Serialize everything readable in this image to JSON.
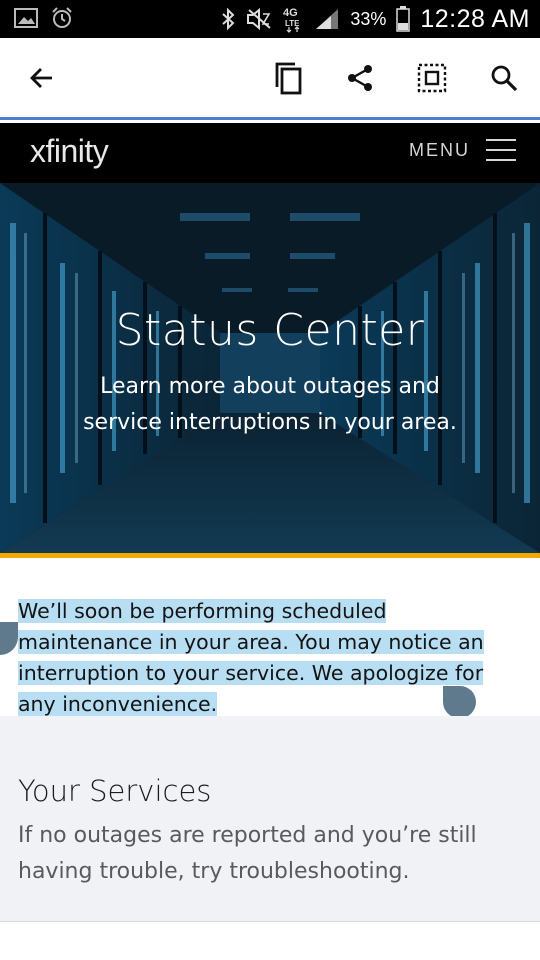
{
  "status_bar": {
    "battery_percent": "33%",
    "time": "12:28 AM",
    "network": "4G LTE",
    "icons": [
      "image-icon",
      "alarm-clock-icon",
      "bluetooth-icon",
      "mute-icon",
      "network-4g-icon",
      "signal-icon",
      "battery-icon"
    ]
  },
  "toolbar": {
    "icons": [
      "back-arrow-icon",
      "copy-icon",
      "share-icon",
      "select-all-icon",
      "search-icon"
    ]
  },
  "site_header": {
    "logo": "xfinity",
    "menu_label": "MENU"
  },
  "hero": {
    "title": "Status Center",
    "subtitle": "Learn more about outages and service interruptions in your area."
  },
  "notice": {
    "text": "We’ll soon be performing scheduled maintenance in your area. You may notice an interruption to your service. We apologize for any inconvenience."
  },
  "services": {
    "title": "Your Services",
    "description": "If no outages are reported and you’re still having trouble, try troubleshooting."
  },
  "colors": {
    "accent_stripe": "#f2a800",
    "selection": "#b7def3",
    "toolbar_border": "#4a7fd4",
    "services_bg": "#f1f2f6"
  }
}
